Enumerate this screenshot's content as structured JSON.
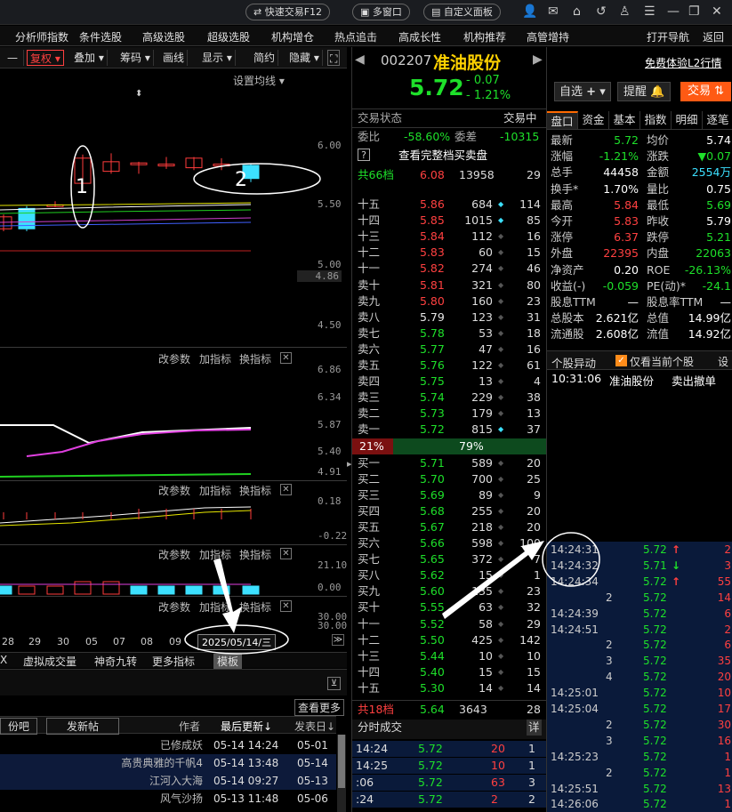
{
  "topbar": {
    "quick_trade": "快速交易F12",
    "multi_window": "多窗口",
    "custom_panel": "自定义面板",
    "icons": [
      "user-icon",
      "mail-icon",
      "home-icon",
      "back-icon",
      "shirt-icon",
      "list-icon",
      "minimize-icon",
      "restore-icon",
      "close-icon"
    ]
  },
  "menu": [
    "分析师指数",
    "条件选股",
    "高级选股",
    "超级选股",
    "机构增仓",
    "热点追击",
    "高成长性",
    "机构推荐",
    "高管增持",
    "打开导航",
    "返回"
  ],
  "chart_toolbar": [
    "复权",
    "叠加",
    "筹码",
    "画线",
    "显示",
    "简约",
    "隐藏"
  ],
  "chart": {
    "ma_setting": "设置均线",
    "main_y": [
      "6.00",
      "5.50",
      "5.00",
      "4.86",
      "4.50"
    ],
    "panel_links": [
      "改参数",
      "加指标",
      "换指标"
    ],
    "p2_y": [
      "6.86",
      "6.34",
      "5.87",
      "5.40",
      "4.91"
    ],
    "p3_y": [
      "0.18",
      "-0.22"
    ],
    "p4_y": [
      "21.10",
      "0.00"
    ],
    "p5_y": [
      "30.00",
      "30.00"
    ],
    "x_labels": [
      "28",
      "29",
      "30",
      "05",
      "07",
      "08",
      "09"
    ],
    "cursor_date": "2025/05/14/三",
    "annot1": "1",
    "annot2": "2",
    "candles": [
      {
        "o": 5.3,
        "c": 5.4,
        "h": 5.42,
        "l": 5.28
      },
      {
        "o": 5.47,
        "c": 5.3,
        "h": 5.49,
        "l": 5.28
      },
      {
        "o": 5.5,
        "c": 5.5,
        "h": 5.53,
        "l": 5.48
      },
      {
        "o": 5.68,
        "c": 5.89,
        "h": 5.92,
        "l": 5.62
      },
      {
        "o": 5.78,
        "c": 5.86,
        "h": 5.93,
        "l": 5.76
      },
      {
        "o": 5.85,
        "c": 5.85,
        "h": 5.86,
        "l": 5.76
      },
      {
        "o": 5.84,
        "c": 5.84,
        "h": 5.9,
        "l": 5.8
      },
      {
        "o": 5.81,
        "c": 5.89,
        "h": 5.9,
        "l": 5.79
      },
      {
        "o": 5.84,
        "c": 5.84,
        "h": 5.89,
        "l": 5.79
      },
      {
        "o": 5.83,
        "c": 5.72,
        "h": 5.84,
        "l": 5.69
      }
    ]
  },
  "bottom_tabs": [
    "X",
    "虚拟成交量",
    "神奇九转",
    "更多指标",
    "模板"
  ],
  "bbs": {
    "view_more": "查看更多",
    "bar_left": "份吧",
    "post": "发新帖",
    "col_author": "作者",
    "col_update": "最后更新↓",
    "col_post": "发表日↓",
    "rows": [
      [
        "已修成妖",
        "05-14 14:24",
        "05-01"
      ],
      [
        "高贵典雅的千帆4",
        "05-14 13:48",
        "05-14"
      ],
      [
        "江河入大海",
        "05-14 09:27",
        "05-13"
      ],
      [
        "风气沙扬",
        "05-13 11:48",
        "05-06"
      ]
    ]
  },
  "stock": {
    "code": "002207",
    "name": "准油股份",
    "price": "5.72",
    "chg": "- 0.07",
    "pct": "- 1.21%",
    "l2": "免费体验L2行情",
    "watch": "自选",
    "alert": "提醒",
    "trade": "交易"
  },
  "book": {
    "status_label": "交易状态",
    "status": "交易中",
    "wb_label": "委比",
    "wb": "-58.60%",
    "wc_label": "委差",
    "wc": "-10315",
    "full_book": "查看完整档买卖盘",
    "sell_total": [
      "共66档",
      "6.08",
      "13958",
      "29"
    ],
    "asks": [
      [
        "十五",
        "5.86",
        "684",
        "114"
      ],
      [
        "十四",
        "5.85",
        "1015",
        "85"
      ],
      [
        "十三",
        "5.84",
        "112",
        "16"
      ],
      [
        "十二",
        "5.83",
        "60",
        "15"
      ],
      [
        "十一",
        "5.82",
        "274",
        "46"
      ],
      [
        "卖十",
        "5.81",
        "321",
        "80"
      ],
      [
        "卖九",
        "5.80",
        "160",
        "23"
      ],
      [
        "卖八",
        "5.79",
        "123",
        "31"
      ],
      [
        "卖七",
        "5.78",
        "53",
        "18"
      ],
      [
        "卖六",
        "5.77",
        "47",
        "16"
      ],
      [
        "卖五",
        "5.76",
        "122",
        "61"
      ],
      [
        "卖四",
        "5.75",
        "13",
        "4"
      ],
      [
        "卖三",
        "5.74",
        "229",
        "38"
      ],
      [
        "卖二",
        "5.73",
        "179",
        "13"
      ],
      [
        "卖一",
        "5.72",
        "815",
        "37"
      ]
    ],
    "ratio_sell": "21%",
    "ratio_buy": "79%",
    "ratio_sell_frac": 0.21,
    "bids": [
      [
        "买一",
        "5.71",
        "589",
        "20"
      ],
      [
        "买二",
        "5.70",
        "700",
        "25"
      ],
      [
        "买三",
        "5.69",
        "89",
        "9"
      ],
      [
        "买四",
        "5.68",
        "255",
        "20"
      ],
      [
        "买五",
        "5.67",
        "218",
        "20"
      ],
      [
        "买六",
        "5.66",
        "598",
        "100"
      ],
      [
        "买七",
        "5.65",
        "372",
        "7"
      ],
      [
        "买八",
        "5.62",
        "15",
        "1"
      ],
      [
        "买九",
        "5.60",
        "135",
        "23"
      ],
      [
        "买十",
        "5.55",
        "63",
        "32"
      ],
      [
        "十一",
        "5.52",
        "58",
        "29"
      ],
      [
        "十二",
        "5.50",
        "425",
        "142"
      ],
      [
        "十三",
        "5.44",
        "10",
        "10"
      ],
      [
        "十四",
        "5.40",
        "15",
        "15"
      ],
      [
        "十五",
        "5.30",
        "14",
        "14"
      ]
    ],
    "buy_total": [
      "共18档",
      "5.64",
      "3643",
      "28"
    ],
    "ticks_title": "分时成交",
    "ticks_detail": "详",
    "ticks": [
      [
        "14:24",
        "5.72",
        "20",
        "1"
      ],
      [
        "14:25",
        "5.72",
        "10",
        "1"
      ],
      [
        ":06",
        "5.72",
        "63",
        "3"
      ],
      [
        ":24",
        "5.72",
        "2",
        "2"
      ]
    ]
  },
  "right": {
    "tabs": [
      "盘口",
      "资金",
      "基本",
      "指数",
      "明细",
      "逐笔"
    ],
    "kv": [
      [
        "最新",
        "5.72",
        "均价",
        "5.74"
      ],
      [
        "涨幅",
        "-1.21%",
        "涨跌",
        "▼0.07"
      ],
      [
        "总手",
        "44458",
        "金额",
        "2554万"
      ],
      [
        "换手*",
        "1.70%",
        "量比",
        "0.75"
      ],
      [
        "最高",
        "5.84",
        "最低",
        "5.69"
      ],
      [
        "今开",
        "5.83",
        "昨收",
        "5.79"
      ],
      [
        "涨停",
        "6.37",
        "跌停",
        "5.21"
      ],
      [
        "外盘",
        "22395",
        "内盘",
        "22063"
      ],
      [
        "净资产",
        "0.20",
        "ROE",
        "-26.13%"
      ],
      [
        "收益(-)",
        "-0.059",
        "PE(动)*",
        "-24.1"
      ],
      [
        "股息TTM",
        "—",
        "股息率TTM",
        "—"
      ],
      [
        "总股本",
        "2.621亿",
        "总值",
        "14.99亿"
      ],
      [
        "流通股",
        "2.608亿",
        "流值",
        "14.92亿"
      ]
    ],
    "anomaly": "个股异动",
    "only_current": "仅看当前个股",
    "settings": "设",
    "alert_row": [
      "10:31:06",
      "准油股份",
      "卖出撤单"
    ],
    "trades": [
      [
        "14:24:31",
        "5.72",
        "↑",
        "2"
      ],
      [
        "14:24:32",
        "5.71",
        "↓",
        "3"
      ],
      [
        "14:24:34",
        "5.72",
        "↑",
        "55"
      ],
      [
        "2",
        "5.72",
        "",
        "14"
      ],
      [
        "14:24:39",
        "5.72",
        "",
        "6"
      ],
      [
        "14:24:51",
        "5.72",
        "",
        "2"
      ],
      [
        "2",
        "5.72",
        "",
        "6"
      ],
      [
        "3",
        "5.72",
        "",
        "35"
      ],
      [
        "4",
        "5.72",
        "",
        "20"
      ],
      [
        "14:25:01",
        "5.72",
        "",
        "10"
      ],
      [
        "14:25:04",
        "5.72",
        "",
        "17"
      ],
      [
        "2",
        "5.72",
        "",
        "30"
      ],
      [
        "3",
        "5.72",
        "",
        "16"
      ],
      [
        "14:25:23",
        "5.72",
        "",
        "1"
      ],
      [
        "2",
        "5.72",
        "",
        "1"
      ],
      [
        "14:25:51",
        "5.72",
        "",
        "13"
      ],
      [
        "14:26:06",
        "5.72",
        "",
        "1"
      ]
    ]
  }
}
